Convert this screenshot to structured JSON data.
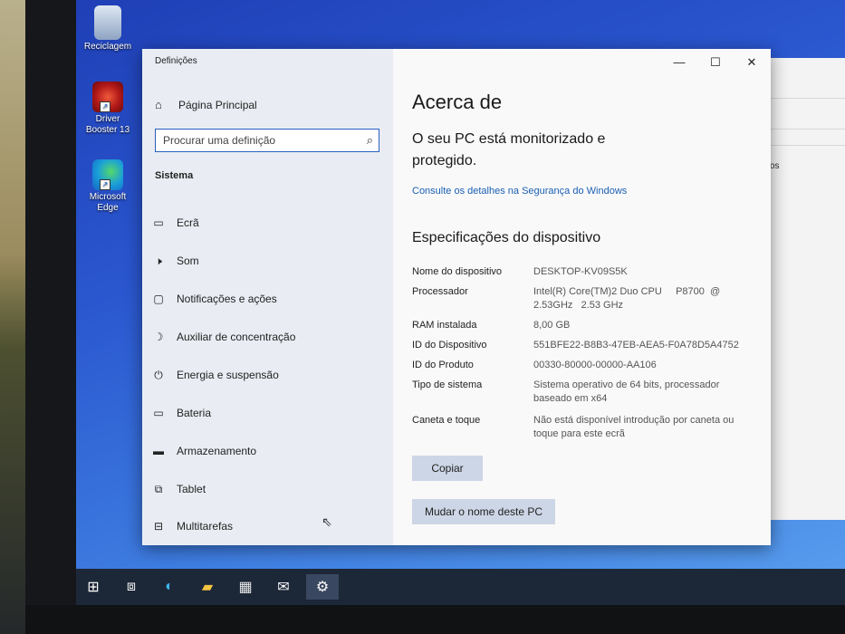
{
  "desktop": {
    "icons": [
      {
        "label": "Reciclagem",
        "icon": "recycle-bin-icon"
      },
      {
        "label": "Driver Booster 13",
        "icon": "driver-booster-icon"
      },
      {
        "label": "Microsoft Edge",
        "icon": "edge-icon"
      }
    ],
    "background_window_text": "os"
  },
  "settings": {
    "window_title": "Definições",
    "home_label": "Página Principal",
    "search_placeholder": "Procurar uma definição",
    "section": "Sistema",
    "nav": [
      {
        "label": "Ecrã",
        "icon": "monitor-icon"
      },
      {
        "label": "Som",
        "icon": "speaker-icon"
      },
      {
        "label": "Notificações e ações",
        "icon": "notification-icon"
      },
      {
        "label": "Auxiliar de concentração",
        "icon": "moon-icon"
      },
      {
        "label": "Energia e suspensão",
        "icon": "power-icon"
      },
      {
        "label": "Bateria",
        "icon": "battery-icon"
      },
      {
        "label": "Armazenamento",
        "icon": "storage-icon"
      },
      {
        "label": "Tablet",
        "icon": "tablet-icon"
      },
      {
        "label": "Multitarefas",
        "icon": "multitasking-icon"
      }
    ],
    "content": {
      "title": "Acerca de",
      "protected_text": "O seu PC está monitorizado e protegido.",
      "security_link": "Consulte os detalhes na Segurança do Windows",
      "spec_heading": "Especificações do dispositivo",
      "specs": [
        {
          "key": "Nome do dispositivo",
          "value": "DESKTOP-KV09S5K"
        },
        {
          "key": "Processador",
          "value": "Intel(R) Core(TM)2 Duo CPU     P8700  @ 2.53GHz   2.53 GHz"
        },
        {
          "key": "RAM instalada",
          "value": "8,00 GB"
        },
        {
          "key": "ID do Dispositivo",
          "value": "551BFE22-B8B3-47EB-AEA5-F0A78D5A4752"
        },
        {
          "key": "ID do Produto",
          "value": "00330-80000-00000-AA106"
        },
        {
          "key": "Tipo de sistema",
          "value": "Sistema operativo de 64 bits, processador baseado em x64"
        },
        {
          "key": "Caneta e toque",
          "value": "Não está disponível introdução por caneta ou toque para este ecrã"
        }
      ],
      "copy_button": "Copiar",
      "rename_button": "Mudar o nome deste PC"
    }
  },
  "taskbar": {
    "icons": [
      "windows-start-icon",
      "task-view-icon",
      "edge-icon",
      "file-explorer-icon",
      "store-icon",
      "mail-icon",
      "settings-gear-icon"
    ]
  }
}
